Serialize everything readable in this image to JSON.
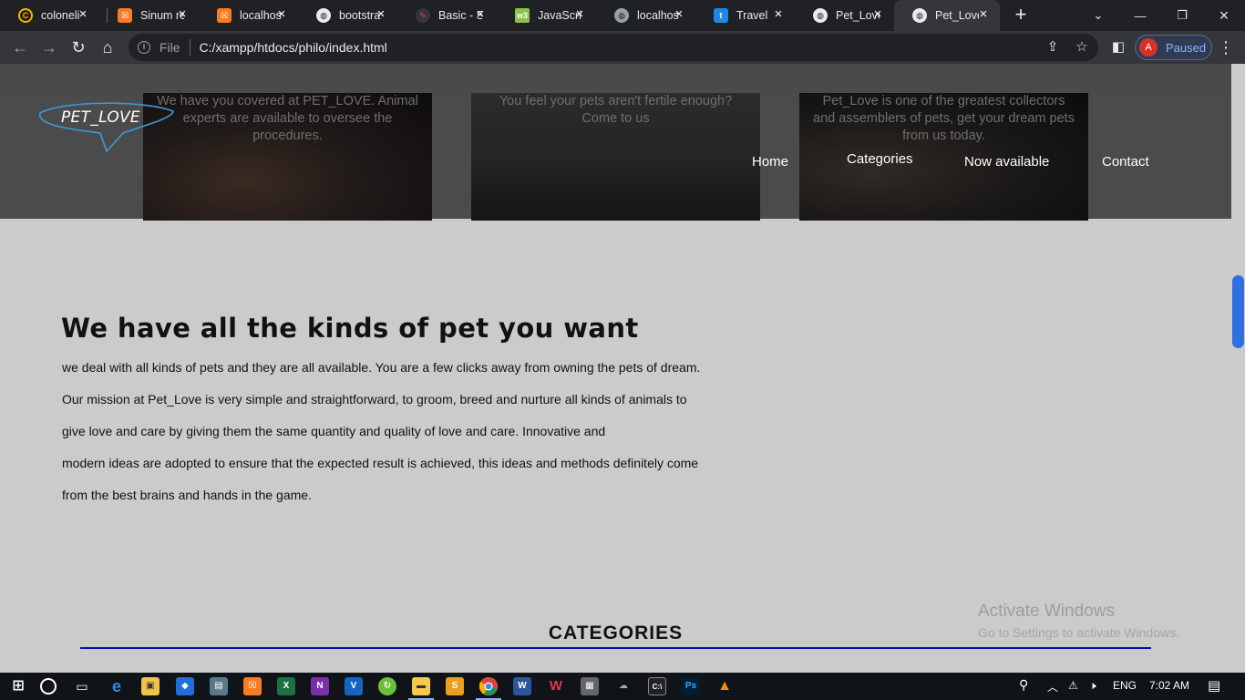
{
  "browser": {
    "tabs": [
      {
        "title": "coloneli",
        "icon": "github-icon",
        "color": "#f4b400"
      },
      {
        "title": "Sinum re",
        "icon": "xampp-icon",
        "color": "#fb7a24"
      },
      {
        "title": "localhos",
        "icon": "xampp-icon",
        "color": "#fb7a24"
      },
      {
        "title": "bootstra",
        "icon": "globe-icon",
        "color": "#e8eaed"
      },
      {
        "title": "Basic - S",
        "icon": "pen-icon",
        "color": "#e8334a"
      },
      {
        "title": "JavaScri",
        "icon": "w3-icon",
        "color": "#8bc34a"
      },
      {
        "title": "localhos",
        "icon": "globe-icon",
        "color": "#9aa0a6"
      },
      {
        "title": "Travel",
        "icon": "travel-icon",
        "color": "#1e88e5"
      },
      {
        "title": "Pet_Love",
        "icon": "globe-icon",
        "color": "#e8eaed"
      },
      {
        "title": "Pet_Love",
        "icon": "globe-icon",
        "color": "#e8eaed"
      }
    ],
    "url_protocol": "File",
    "url": "C:/xampp/htdocs/philo/index.html",
    "profile_initial": "A",
    "profile_status": "Paused"
  },
  "page": {
    "logo": "PET_LOVE",
    "cards": [
      "We have you covered at PET_LOVE. Animal experts are available to oversee the procedures.",
      "You feel your pets aren't fertile enough? Come to us",
      "Pet_Love is one of the greatest collectors and assemblers of pets, get your dream pets from us today."
    ],
    "nav": {
      "home": "Home",
      "categories": "Categories",
      "now_available": "Now available",
      "contact": "Contact"
    },
    "title": "We have all the kinds of pet you want",
    "paragraphs": [
      "we deal with all kinds of pets and they are all available. You are a few clicks away from owning the pets of dream.",
      "Our mission at Pet_Love is very simple and straightforward, to groom, breed and nurture all kinds of animals to",
      "give love and care by giving them the same quantity and quality of love and care. Innovative and",
      "modern ideas are adopted to ensure that the expected result is achieved, this ideas and methods definitely come",
      "from the best brains and hands in the game."
    ],
    "watermark_title": "Activate Windows",
    "watermark_sub": "Go to Settings to activate Windows.",
    "categories_heading": "CATEGORIES"
  },
  "taskbar": {
    "language": "ENG",
    "time": "7:02 AM"
  }
}
